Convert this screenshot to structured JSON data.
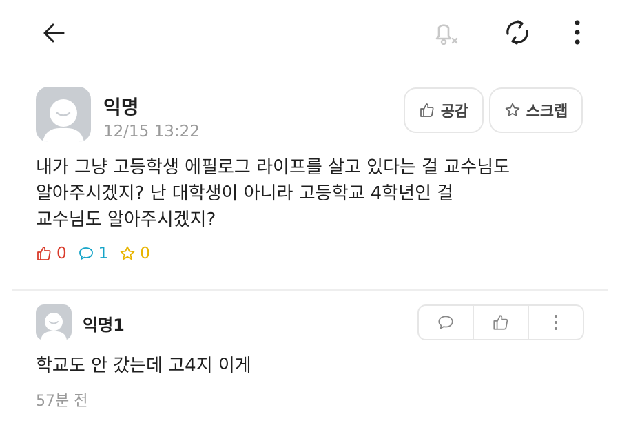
{
  "toolbar": {
    "back_icon": "arrow-left-icon",
    "notify_icon": "bell-off-icon",
    "refresh_icon": "refresh-icon",
    "more_icon": "more-vertical-icon"
  },
  "post": {
    "author": "익명",
    "time": "12/15 13:22",
    "like_button": "공감",
    "scrap_button": "스크랩",
    "body_lines": [
      "내가 그냥 고등학생 에필로그 라이프를 살고 있다는 걸 교수님도",
      "알아주시겠지? 난 대학생이 아니라 고등학교 4학년인 걸",
      "교수님도 알아주시겠지?"
    ],
    "likes": "0",
    "comments": "1",
    "scraps": "0"
  },
  "comment": {
    "author": "익명1",
    "text": "학교도 안 갔는데 고4지 이게",
    "time": "57분 전"
  },
  "colors": {
    "like": "#d93b2b",
    "comment": "#15a4c8",
    "scrap": "#e8b400",
    "muted": "#9a9a9a",
    "border": "#e6e6e6"
  }
}
